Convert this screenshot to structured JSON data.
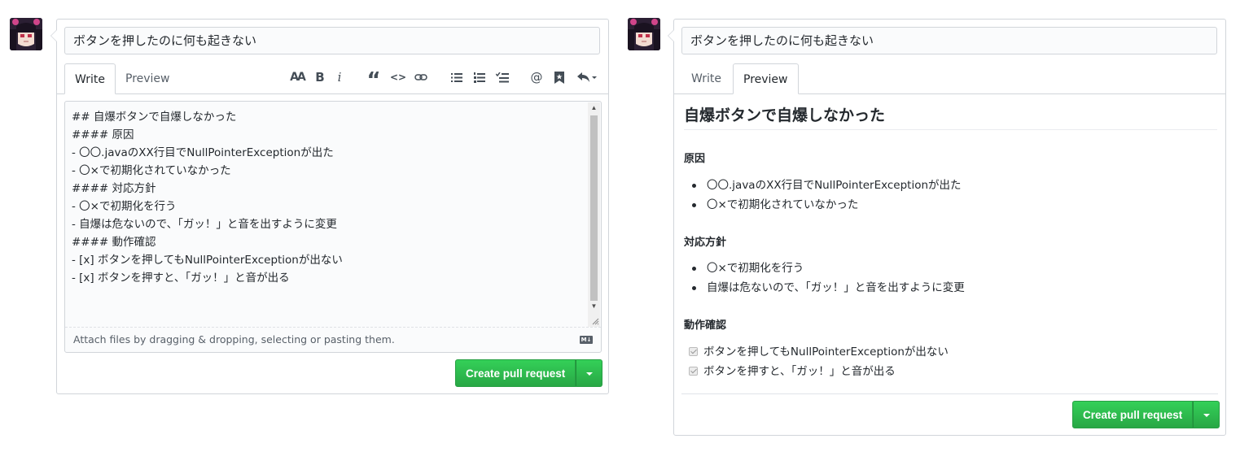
{
  "left": {
    "title_value": "ボタンを押したのに何も起きない",
    "tabs": [
      {
        "label": "Write"
      },
      {
        "label": "Preview"
      }
    ],
    "toolbar": {
      "header": "AA",
      "bold": "B",
      "italic": "i",
      "quote": "“",
      "code": "<>",
      "mention": "@"
    },
    "body_lines": [
      "## 自爆ボタンで自爆しなかった",
      "#### 原因",
      "- 〇〇.javaのXX行目でNullPointerExceptionが出た",
      "- 〇×で初期化されていなかった",
      "#### 対応方針",
      "- 〇×で初期化を行う",
      "- 自爆は危ないので、「ガッ！」と音を出すように変更",
      "#### 動作確認",
      "- [x] ボタンを押してもNullPointerExceptionが出ない",
      "- [x] ボタンを押すと、「ガッ！」と音が出る"
    ],
    "attach_text": "Attach files by dragging & dropping, selecting or pasting them.",
    "markdown_badge": "M↓",
    "submit_label": "Create pull request"
  },
  "right": {
    "title_value": "ボタンを押したのに何も起きない",
    "tabs": [
      {
        "label": "Write"
      },
      {
        "label": "Preview"
      }
    ],
    "preview": {
      "h2": "自爆ボタンで自爆しなかった",
      "sections": [
        {
          "heading": "原因",
          "items": [
            "〇〇.javaのXX行目でNullPointerExceptionが出た",
            "〇×で初期化されていなかった"
          ]
        },
        {
          "heading": "対応方針",
          "items": [
            "〇×で初期化を行う",
            "自爆は危ないので、「ガッ！」と音を出すように変更"
          ]
        },
        {
          "heading": "動作確認",
          "tasks": [
            "ボタンを押してもNullPointerExceptionが出ない",
            "ボタンを押すと、「ガッ！」と音が出る"
          ]
        }
      ]
    },
    "submit_label": "Create pull request"
  },
  "colors": {
    "accent_green": "#28a745",
    "border": "#d1d5da"
  }
}
